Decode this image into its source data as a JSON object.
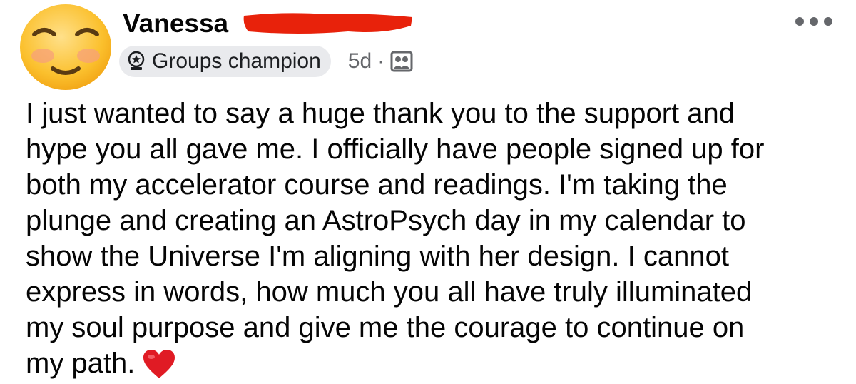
{
  "post": {
    "author": "Vanessa",
    "badge": "Groups champion",
    "time": "5d",
    "separator": "·",
    "audience_icon": "group-icon",
    "more_icon": "more-dots-icon",
    "avatar_icon": "smiling-face-emoji",
    "body": "I just wanted to say a huge thank you to the support and\nhype you all gave me. I officially have people signed up for\nboth my accelerator course and readings. I'm taking the\nplunge and creating an AstroPsych day in my calendar to\nshow the Universe I'm aligning with her design. I cannot\nexpress in words, how much you all have truly illuminated\nmy soul purpose and give me the courage to continue on\nmy path.",
    "end_emoji": "red-heart-emoji"
  },
  "colors": {
    "text": "#050505",
    "meta": "#65676b",
    "badge_bg": "#e9eaed",
    "redaction": "#e8220b",
    "heart": "#e01b24"
  }
}
